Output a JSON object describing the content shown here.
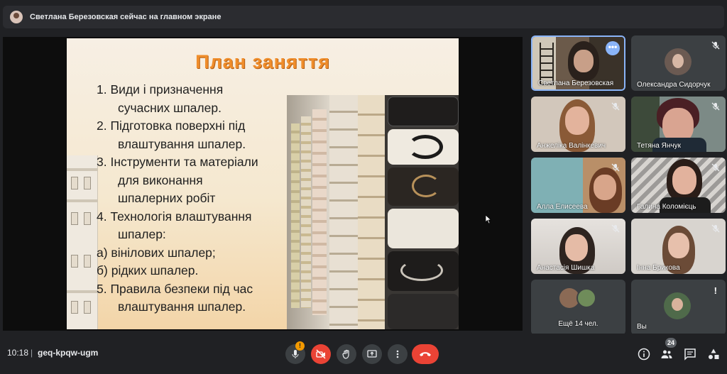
{
  "banner": {
    "text": "Светлана Березовская сейчас на главном экране"
  },
  "slide": {
    "title": "План заняття",
    "lines": [
      {
        "text": "1.   Види  і призначення",
        "indent": false
      },
      {
        "text": "сучасних шпалер.",
        "indent": true
      },
      {
        "text": "2.   Підготовка поверхні під",
        "indent": false
      },
      {
        "text": "влаштування шпалер.",
        "indent": true
      },
      {
        "text": "3.   Інструменти та матеріали",
        "indent": false
      },
      {
        "text": "для виконання",
        "indent": true
      },
      {
        "text": "шпалерних робіт",
        "indent": true
      },
      {
        "text": "4. Технологія влаштування",
        "indent": false
      },
      {
        "text": "шпалер:",
        "indent": true
      },
      {
        "text": "а) вінілових шпалер;",
        "indent": false
      },
      {
        "text": "б) рідких шпалер.",
        "indent": false
      },
      {
        "text": "5. Правила безпеки під час",
        "indent": false
      },
      {
        "text": "влаштування шпалер.",
        "indent": true
      }
    ]
  },
  "participants": [
    {
      "name": "Светлана Березовская",
      "muted": false,
      "active": true
    },
    {
      "name": "Олександра Сидорчук",
      "muted": true
    },
    {
      "name": "Анжеліка Валінкевич",
      "muted": true
    },
    {
      "name": "Тетяна Янчук",
      "muted": true
    },
    {
      "name": "Алла Елисеева",
      "muted": true
    },
    {
      "name": "Галина Коломієць",
      "muted": true
    },
    {
      "name": "Анастасія Шишка",
      "muted": true
    },
    {
      "name": "Інна Брикова",
      "muted": true
    },
    {
      "name": "Ещё 14 чел.",
      "muted": false
    },
    {
      "name": "Вы",
      "muted": false,
      "alert": "!"
    }
  ],
  "toolbar": {
    "time": "10:18",
    "separator": "|",
    "meeting_code": "geq-kpqw-ugm",
    "mic_warning": "!",
    "participant_count": "24"
  },
  "colors": {
    "background": "#202124",
    "tile": "#3c4043",
    "accent": "#8ab4f8",
    "danger": "#ea4335",
    "title_orange": "#ef8d2b"
  },
  "icons": [
    "mic-icon",
    "camera-off-icon",
    "raise-hand-icon",
    "present-icon",
    "more-options-icon",
    "end-call-icon",
    "info-icon",
    "people-icon",
    "chat-icon",
    "activities-icon"
  ]
}
